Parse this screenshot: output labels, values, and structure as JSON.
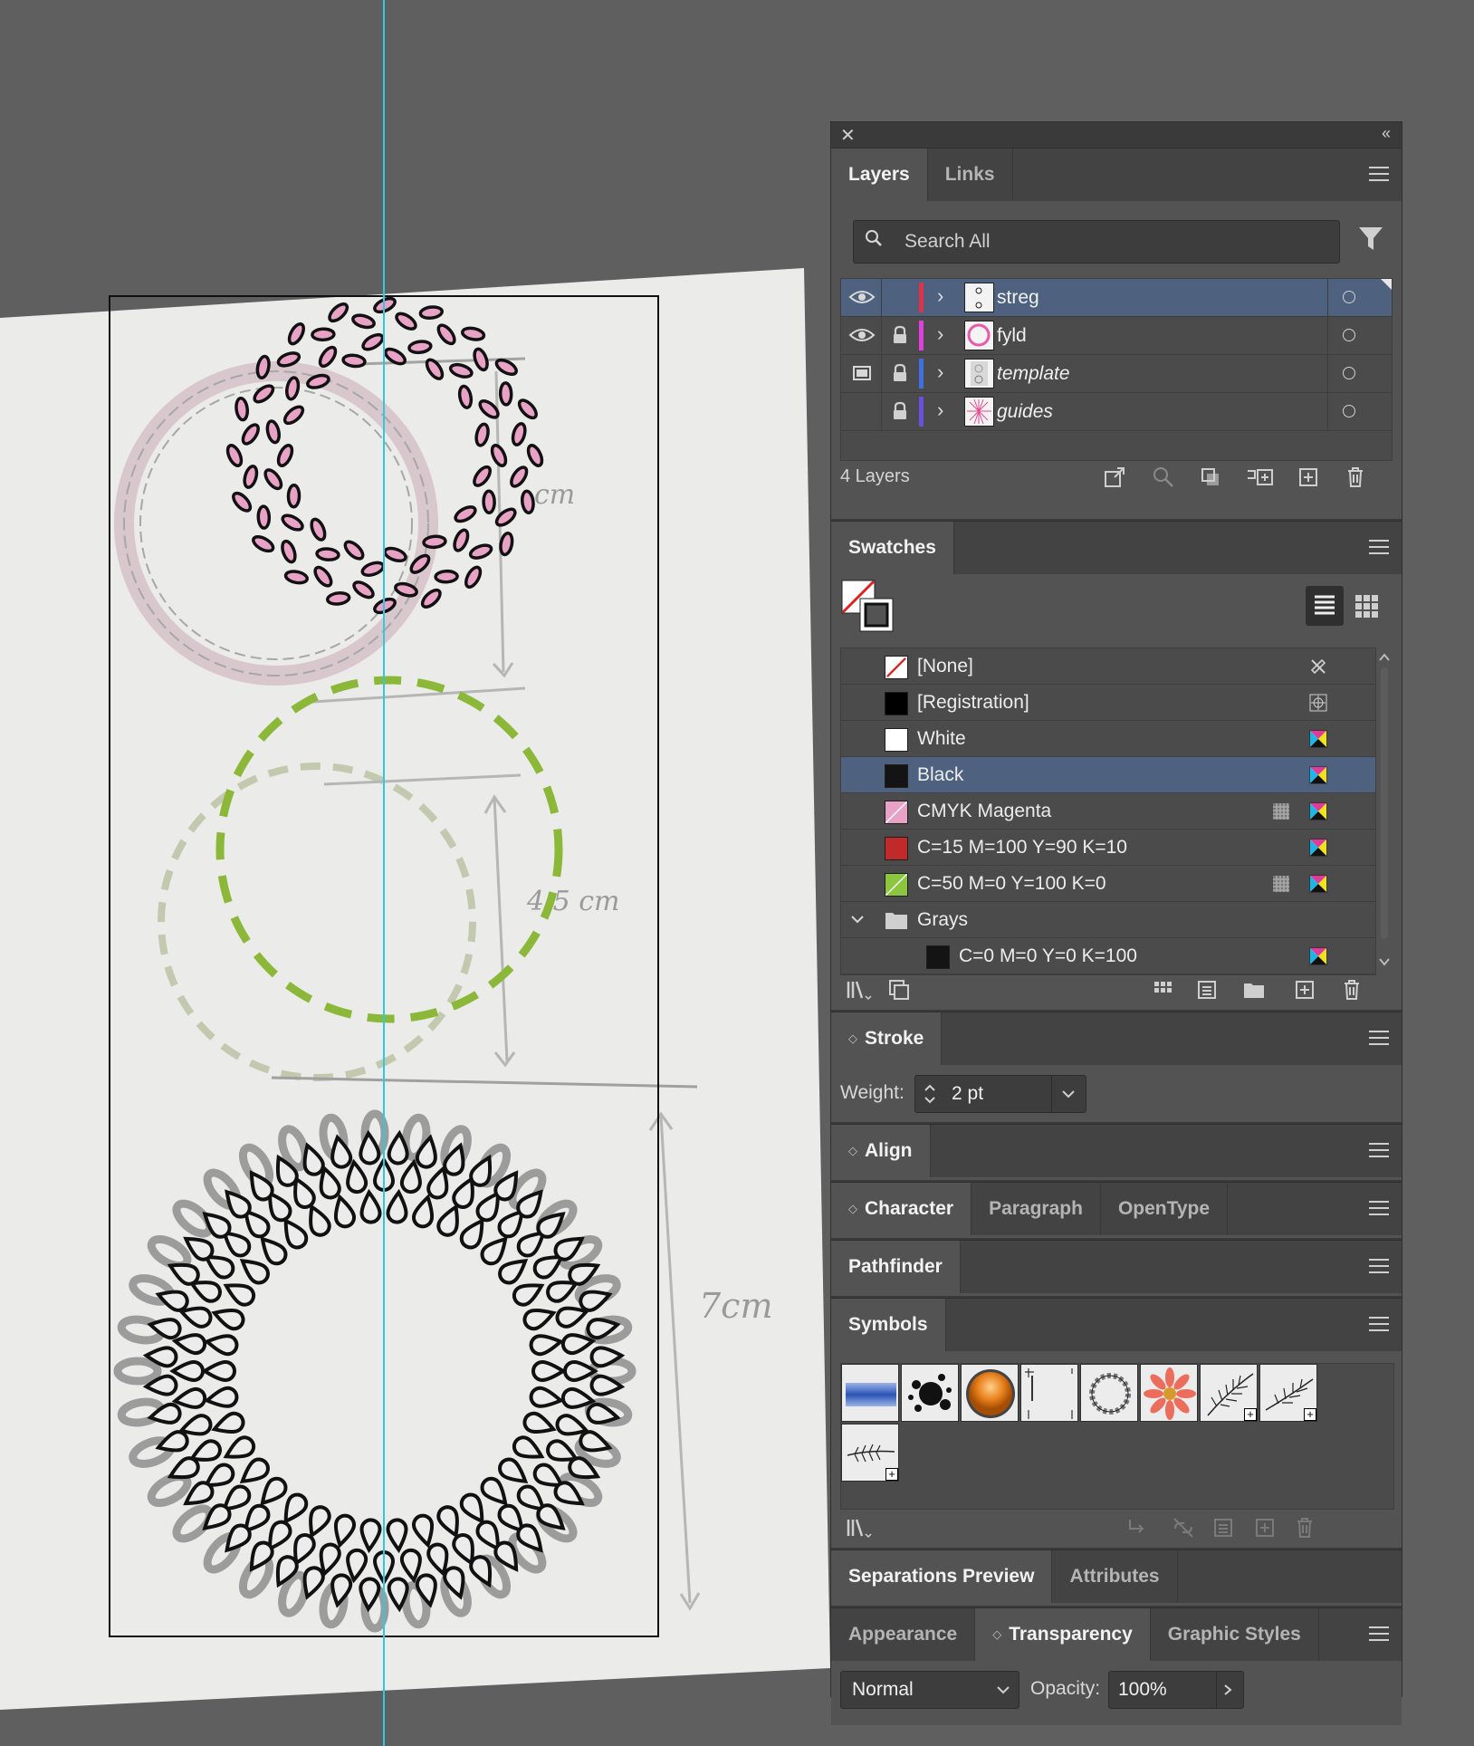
{
  "canvas": {
    "annotations": [
      "cm",
      "4,5 cm",
      "7cm"
    ],
    "guide_color": "#2ec8e0"
  },
  "panel": {
    "layers": {
      "tabs": [
        "Layers",
        "Links"
      ],
      "search_placeholder": "Search All",
      "rows": [
        {
          "name": "streg",
          "color": "#e0334a",
          "visible": true,
          "locked": false,
          "selected": true,
          "italic": false
        },
        {
          "name": "fyld",
          "color": "#e03fe0",
          "visible": true,
          "locked": true,
          "selected": false,
          "italic": false
        },
        {
          "name": "template",
          "color": "#3f6fe0",
          "visible": "template",
          "locked": true,
          "selected": false,
          "italic": true
        },
        {
          "name": "guides",
          "color": "#6a4fe0",
          "visible": false,
          "locked": true,
          "selected": false,
          "italic": true
        }
      ],
      "count_label": "4 Layers"
    },
    "swatches": {
      "tab": "Swatches",
      "rows": [
        {
          "name": "[None]",
          "chip": "none"
        },
        {
          "name": "[Registration]",
          "chip": "#000000"
        },
        {
          "name": "White",
          "chip": "#ffffff"
        },
        {
          "name": "Black",
          "chip": "#141414",
          "selected": true
        },
        {
          "name": "CMYK Magenta",
          "chip": "magenta"
        },
        {
          "name": "C=15 M=100 Y=90 K=10",
          "chip": "#c02a2a"
        },
        {
          "name": "C=50 M=0 Y=100 K=0",
          "chip": "green"
        },
        {
          "name": "Grays",
          "chip": "folder"
        },
        {
          "name": "C=0 M=0 Y=0 K=100",
          "chip": "#141414"
        }
      ]
    },
    "stroke": {
      "tab": "Stroke",
      "weight_label": "Weight:",
      "weight_value": "2 pt"
    },
    "align": {
      "tab": "Align"
    },
    "type_tabs": [
      "Character",
      "Paragraph",
      "OpenType"
    ],
    "pathfinder": {
      "tab": "Pathfinder"
    },
    "symbols": {
      "tab": "Symbols"
    },
    "sep_tabs": [
      "Separations Preview",
      "Attributes"
    ],
    "transparency": {
      "tabs": [
        "Appearance",
        "Transparency",
        "Graphic Styles"
      ],
      "blend_mode": "Normal",
      "opacity_label": "Opacity:",
      "opacity_value": "100%"
    }
  }
}
